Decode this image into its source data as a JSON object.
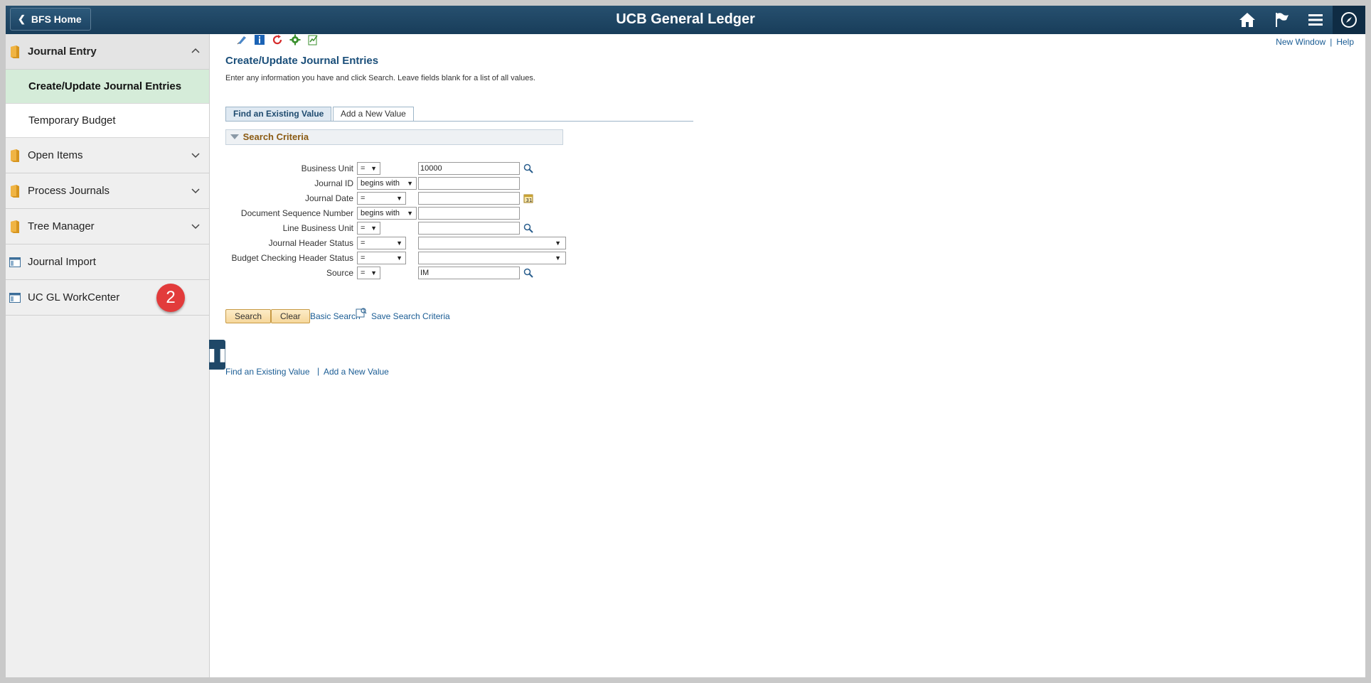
{
  "header": {
    "home_label": "BFS Home",
    "title": "UCB General Ledger",
    "icons": [
      "home-icon",
      "flag-icon",
      "menu-icon",
      "navbar-compass-icon"
    ]
  },
  "sidebar": {
    "items": [
      {
        "label": "Journal Entry",
        "icon": "folder-icon",
        "expanded": true
      },
      {
        "label": "Create/Update Journal Entries",
        "active": true
      },
      {
        "label": "Temporary Budget"
      },
      {
        "label": "Open Items",
        "icon": "folder-icon"
      },
      {
        "label": "Process Journals",
        "icon": "folder-icon"
      },
      {
        "label": "Tree Manager",
        "icon": "folder-icon"
      },
      {
        "label": "Journal Import",
        "icon": "page-icon"
      },
      {
        "label": "UC GL WorkCenter",
        "icon": "page-icon"
      }
    ],
    "callout_number": "2"
  },
  "content": {
    "top_links": {
      "new_window": "New Window",
      "help": "Help"
    },
    "page_title": "Create/Update Journal Entries",
    "instructions": "Enter any information you have and click Search. Leave fields blank for a list of all values.",
    "tabs": {
      "find": "Find an Existing Value",
      "add": "Add a New Value"
    },
    "search_criteria_title": "Search Criteria",
    "fields": [
      {
        "label": "Business Unit",
        "op": "=",
        "value": "10000"
      },
      {
        "label": "Journal ID",
        "op": "begins with",
        "value": ""
      },
      {
        "label": "Journal Date",
        "op": "=",
        "value": ""
      },
      {
        "label": "Document Sequence Number",
        "op": "begins with",
        "value": ""
      },
      {
        "label": "Line Business Unit",
        "op": "=",
        "value": ""
      },
      {
        "label": "Journal Header Status",
        "op": "=",
        "value": ""
      },
      {
        "label": "Budget Checking Header Status",
        "op": "=",
        "value": ""
      },
      {
        "label": "Source",
        "op": "=",
        "value": "IM"
      }
    ],
    "buttons": {
      "search": "Search",
      "clear": "Clear"
    },
    "links": {
      "basic_search": "Basic Search",
      "save_search": "Save Search Criteria",
      "bottom_find": "Find an Existing Value",
      "bottom_add": "Add a New Value"
    }
  },
  "colors": {
    "header_bg": "#1d4464",
    "active_item": "#d5ecd9",
    "link": "#1a5c94",
    "badge": "#e23b3b"
  }
}
